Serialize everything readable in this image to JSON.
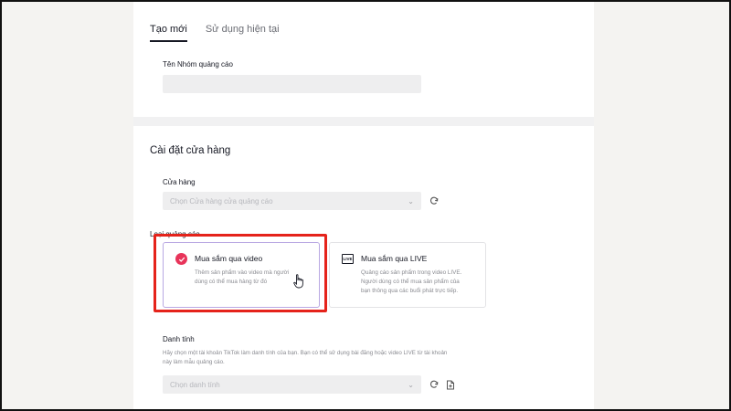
{
  "tabs": [
    {
      "label": "Tạo mới",
      "active": true
    },
    {
      "label": "Sử dụng hiện tại",
      "active": false
    }
  ],
  "ad_group": {
    "label": "Tên Nhóm quảng cáo",
    "value": ""
  },
  "store_settings": {
    "title": "Cài đặt cửa hàng",
    "store": {
      "label": "Cửa hàng",
      "placeholder": "Chọn Cửa hàng cửa quảng cáo"
    },
    "ad_type": {
      "label": "Loại quảng cáo",
      "options": [
        {
          "title": "Mua sắm qua video",
          "description_line1": "Thêm sản phẩm vào video mà người",
          "description_line2": "dùng có thể mua hàng từ đó",
          "selected": true,
          "icon": "check-circle-icon"
        },
        {
          "title": "Mua sắm qua LIVE",
          "description_line1": "Quảng cáo sản phẩm trong video LIVE.",
          "description_line2": "Người dùng có thể mua sản phẩm của",
          "description_line3": "bạn thông qua các buổi phát trực tiếp.",
          "selected": false,
          "icon": "live-icon",
          "icon_text": "LIVE"
        }
      ]
    },
    "identity": {
      "label": "Danh tính",
      "hint_line1": "Hãy chọn một tài khoản TikTok làm danh tính của bạn. Bạn có thể sử dụng bài đăng hoặc video LIVE từ tài khoản",
      "hint_line2": "này làm mẫu quảng cáo.",
      "placeholder": "Chọn danh tính"
    }
  },
  "colors": {
    "accent": "#e8345a",
    "highlight": "#e5231b",
    "selected_border": "#b9a8e3"
  }
}
